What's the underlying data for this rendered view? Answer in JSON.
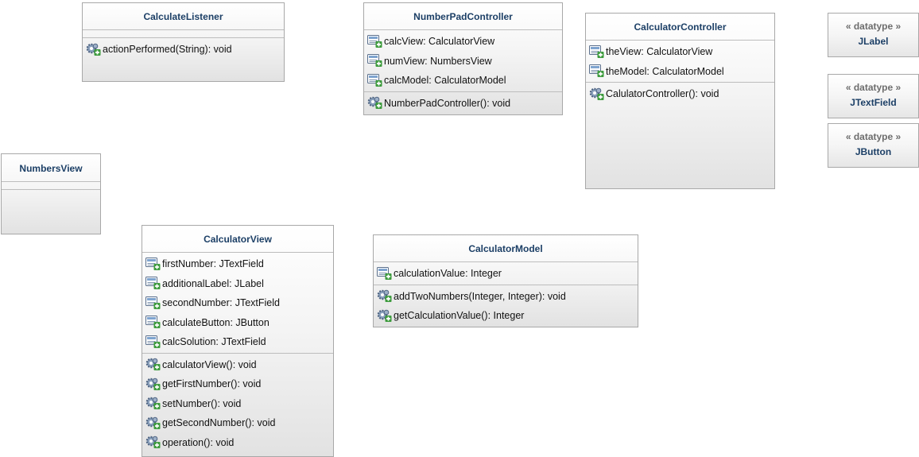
{
  "classes": {
    "calculate_listener": {
      "name": "CalculateListener",
      "attributes": [],
      "operations": [
        "actionPerformed(String): void"
      ]
    },
    "number_pad_controller": {
      "name": "NumberPadController",
      "attributes": [
        "calcView: CalculatorView",
        "numView: NumbersView",
        "calcModel: CalculatorModel"
      ],
      "operations": [
        "NumberPadController(): void"
      ]
    },
    "calculator_controller": {
      "name": "CalculatorController",
      "attributes": [
        "theView: CalculatorView",
        "theModel: CalculatorModel"
      ],
      "operations": [
        "CalulatorController(): void"
      ]
    },
    "numbers_view": {
      "name": "NumbersView",
      "attributes": [],
      "operations": []
    },
    "calculator_view": {
      "name": "CalculatorView",
      "attributes": [
        "firstNumber: JTextField",
        "additionalLabel: JLabel",
        "secondNumber: JTextField",
        "calculateButton: JButton",
        "calcSolution: JTextField"
      ],
      "operations": [
        "calculatorView(): void",
        "getFirstNumber(): void",
        "setNumber(): void",
        "getSecondNumber(): void",
        "operation(): void"
      ]
    },
    "calculator_model": {
      "name": "CalculatorModel",
      "attributes": [
        "calculationValue: Integer"
      ],
      "operations": [
        "addTwoNumbers(Integer, Integer): void",
        "getCalculationValue(): Integer"
      ]
    }
  },
  "datatypes": [
    {
      "stereotype": "« datatype »",
      "name": "JLabel"
    },
    {
      "stereotype": "« datatype »",
      "name": "JTextField"
    },
    {
      "stereotype": "« datatype »",
      "name": "JButton"
    }
  ],
  "icons": {
    "attribute": "public-attribute-icon",
    "operation": "public-operation-icon"
  },
  "colors": {
    "class_name": "#1c3f66",
    "stereotype": "#6d6d6d",
    "border": "#a8a8a8"
  }
}
